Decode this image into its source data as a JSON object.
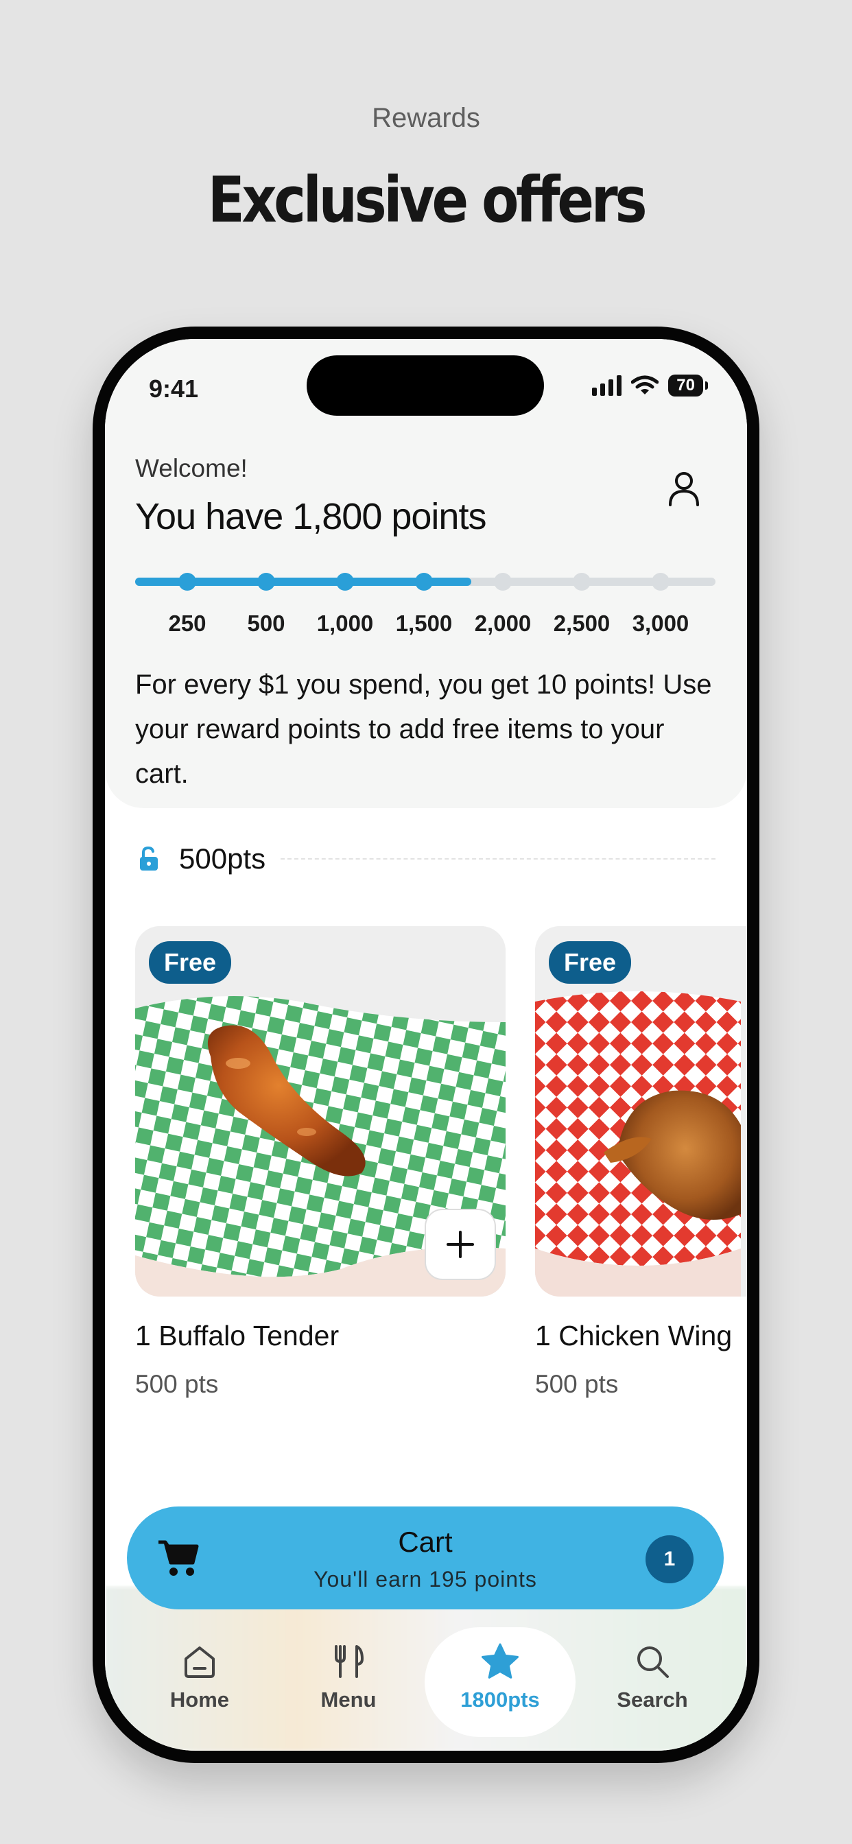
{
  "promo": {
    "subtitle": "Rewards",
    "title": "Exclusive offers"
  },
  "status_bar": {
    "time": "9:41",
    "battery": "70"
  },
  "header": {
    "welcome": "Welcome!",
    "points_title": "You have 1,800 points",
    "current_points": 1800,
    "milestones": [
      {
        "label": "250",
        "value": 250,
        "reached": true
      },
      {
        "label": "500",
        "value": 500,
        "reached": true
      },
      {
        "label": "1,000",
        "value": 1000,
        "reached": true
      },
      {
        "label": "1,500",
        "value": 1500,
        "reached": true
      },
      {
        "label": "2,000",
        "value": 2000,
        "reached": false
      },
      {
        "label": "2,500",
        "value": 2500,
        "reached": false
      },
      {
        "label": "3,000",
        "value": 3000,
        "reached": false
      }
    ],
    "info": "For every $1 you spend, you get 10 points! Use your reward points to add free items to your cart."
  },
  "tier": {
    "label": "500pts",
    "icon": "unlock-icon"
  },
  "rewards": [
    {
      "badge": "Free",
      "name": "1 Buffalo Tender",
      "points": "500 pts",
      "paper_color": "#34a853",
      "food": "tender"
    },
    {
      "badge": "Free",
      "name": "1 Chicken Wing",
      "points": "500 pts",
      "paper_color": "#e8362c",
      "food": "wing"
    }
  ],
  "cart": {
    "title": "Cart",
    "subtitle": "You'll earn 195 points",
    "count": "1"
  },
  "tabs": [
    {
      "label": "Home",
      "icon": "home-icon",
      "active": false
    },
    {
      "label": "Menu",
      "icon": "fork-knife-icon",
      "active": false
    },
    {
      "label": "1800pts",
      "icon": "star-icon",
      "active": true
    },
    {
      "label": "Search",
      "icon": "search-icon",
      "active": false
    }
  ],
  "colors": {
    "accent": "#2a9fd8",
    "cart_bar": "#40b3e3",
    "badge": "#0e5e8c",
    "inactive_milestone": "#d9dde0"
  }
}
